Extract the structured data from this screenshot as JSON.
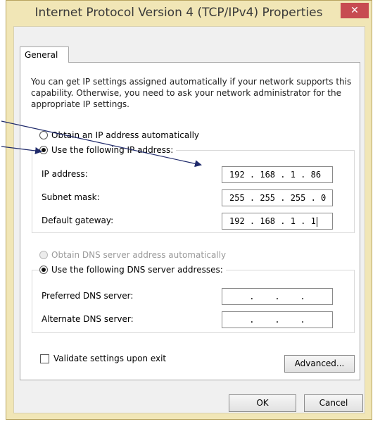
{
  "window": {
    "title": "Internet Protocol Version 4 (TCP/IPv4) Properties",
    "close_glyph": "✕"
  },
  "tabs": [
    {
      "label": "General"
    }
  ],
  "intro_text": "You can get IP settings assigned automatically if your network supports this capability. Otherwise, you need to ask your network administrator for the appropriate IP settings.",
  "ip": {
    "auto_label": "Obtain an IP address automatically",
    "manual_label": "Use the following IP address:",
    "selected": "manual",
    "fields": [
      {
        "label": "IP address:",
        "value": "192 . 168 .  1  . 86"
      },
      {
        "label": "Subnet mask:",
        "value": "255 . 255 . 255 .  0"
      },
      {
        "label": "Default gateway:",
        "value": "192 . 168 .  1  .  1"
      }
    ]
  },
  "dns": {
    "auto_label": "Obtain DNS server address automatically",
    "manual_label": "Use the following DNS server addresses:",
    "selected": "manual",
    "fields": [
      {
        "label": "Preferred DNS server:",
        "value": "  .    .    .  "
      },
      {
        "label": "Alternate DNS server:",
        "value": "  .    .    .  "
      }
    ]
  },
  "validate_label": "Validate settings upon exit",
  "buttons": {
    "advanced": "Advanced...",
    "ok": "OK",
    "cancel": "Cancel"
  },
  "colors": {
    "frame": "#f1e6b6",
    "close": "#c74b51",
    "arrow": "#1f2a6b"
  }
}
